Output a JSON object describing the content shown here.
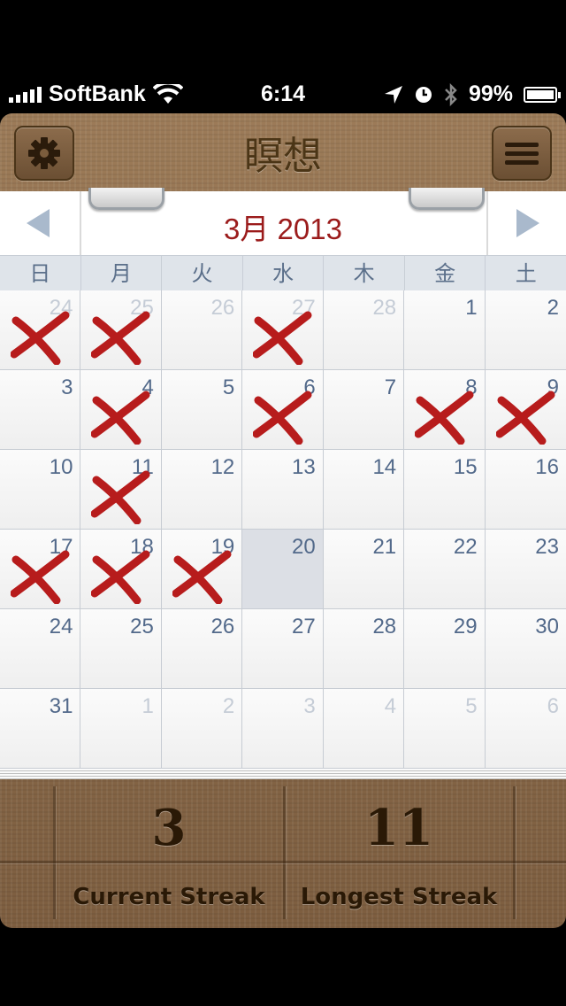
{
  "status_bar": {
    "carrier": "SoftBank",
    "time": "6:14",
    "battery": "99%",
    "battery_level": 0.99
  },
  "header": {
    "title": "瞑想",
    "settings_icon": "gear-icon",
    "list_icon": "list-icon"
  },
  "calendar": {
    "month_label": "3月 2013",
    "weekdays": [
      "日",
      "月",
      "火",
      "水",
      "木",
      "金",
      "土"
    ],
    "mark_color": "#b71c1c",
    "days": [
      {
        "n": "24",
        "other": true,
        "x": true
      },
      {
        "n": "25",
        "other": true,
        "x": true
      },
      {
        "n": "26",
        "other": true,
        "x": false
      },
      {
        "n": "27",
        "other": true,
        "x": true
      },
      {
        "n": "28",
        "other": true,
        "x": false
      },
      {
        "n": "1",
        "other": false,
        "x": false
      },
      {
        "n": "2",
        "other": false,
        "x": false
      },
      {
        "n": "3",
        "other": false,
        "x": false
      },
      {
        "n": "4",
        "other": false,
        "x": true
      },
      {
        "n": "5",
        "other": false,
        "x": false
      },
      {
        "n": "6",
        "other": false,
        "x": true
      },
      {
        "n": "7",
        "other": false,
        "x": false
      },
      {
        "n": "8",
        "other": false,
        "x": true
      },
      {
        "n": "9",
        "other": false,
        "x": true
      },
      {
        "n": "10",
        "other": false,
        "x": false
      },
      {
        "n": "11",
        "other": false,
        "x": true
      },
      {
        "n": "12",
        "other": false,
        "x": false
      },
      {
        "n": "13",
        "other": false,
        "x": false
      },
      {
        "n": "14",
        "other": false,
        "x": false
      },
      {
        "n": "15",
        "other": false,
        "x": false
      },
      {
        "n": "16",
        "other": false,
        "x": false
      },
      {
        "n": "17",
        "other": false,
        "x": true
      },
      {
        "n": "18",
        "other": false,
        "x": true
      },
      {
        "n": "19",
        "other": false,
        "x": true
      },
      {
        "n": "20",
        "other": false,
        "x": false,
        "today": true
      },
      {
        "n": "21",
        "other": false,
        "x": false
      },
      {
        "n": "22",
        "other": false,
        "x": false
      },
      {
        "n": "23",
        "other": false,
        "x": false
      },
      {
        "n": "24",
        "other": false,
        "x": false
      },
      {
        "n": "25",
        "other": false,
        "x": false
      },
      {
        "n": "26",
        "other": false,
        "x": false
      },
      {
        "n": "27",
        "other": false,
        "x": false
      },
      {
        "n": "28",
        "other": false,
        "x": false
      },
      {
        "n": "29",
        "other": false,
        "x": false
      },
      {
        "n": "30",
        "other": false,
        "x": false
      },
      {
        "n": "31",
        "other": false,
        "x": false
      },
      {
        "n": "1",
        "other": true,
        "x": false
      },
      {
        "n": "2",
        "other": true,
        "x": false
      },
      {
        "n": "3",
        "other": true,
        "x": false
      },
      {
        "n": "4",
        "other": true,
        "x": false
      },
      {
        "n": "5",
        "other": true,
        "x": false
      },
      {
        "n": "6",
        "other": true,
        "x": false
      }
    ]
  },
  "streaks": {
    "current_value": "3",
    "current_label": "Current Streak",
    "longest_value": "11",
    "longest_label": "Longest Streak"
  }
}
